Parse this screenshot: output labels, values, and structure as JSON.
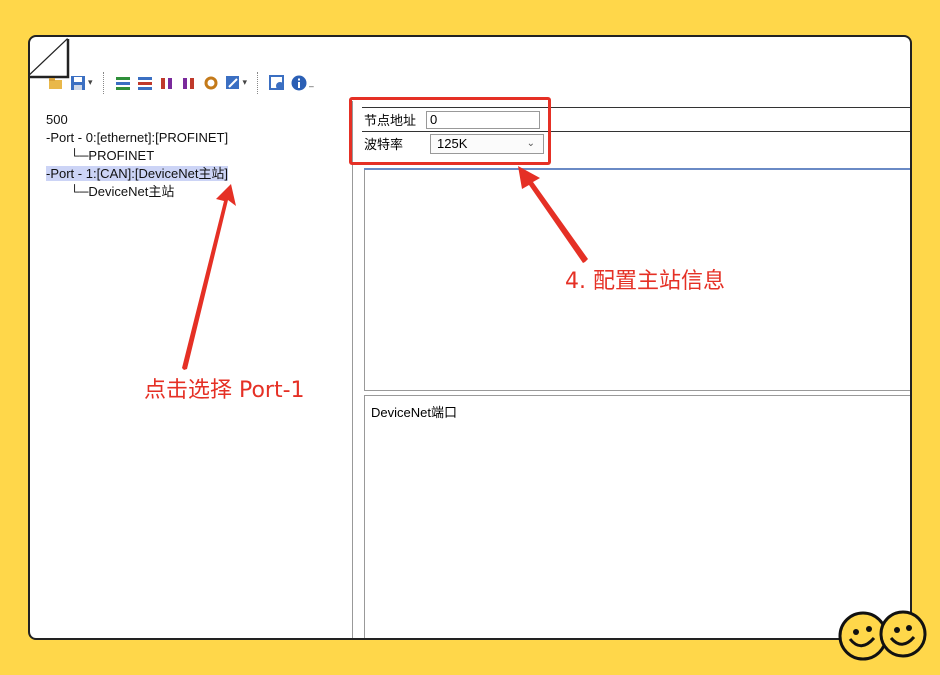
{
  "tree": {
    "root": "500",
    "items": [
      "-Port - 0:[ethernet]:[PROFINET]",
      "└─PROFINET",
      "-Port - 1:[CAN]:[DeviceNet主站]",
      "└─DeviceNet主站"
    ]
  },
  "properties": {
    "node_address_label": "节点地址",
    "node_address_value": "0",
    "baud_rate_label": "波特率",
    "baud_rate_value": "125K",
    "dropdown_arrow": "⌄"
  },
  "description": "DeviceNet端口",
  "annotations": {
    "select_port": "点击选择 Port-1",
    "configure_master": "4. 配置主站信息"
  },
  "colors": {
    "background": "#FFD74A",
    "accent_red": "#E53025",
    "selection": "#CCD4F6"
  }
}
